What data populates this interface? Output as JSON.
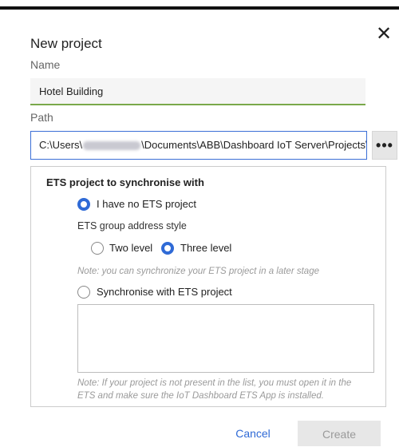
{
  "dialog": {
    "title": "New project",
    "close_icon": "close-icon"
  },
  "name": {
    "label": "Name",
    "value": "Hotel Building"
  },
  "path": {
    "label": "Path",
    "value_prefix": "C:\\Users\\",
    "value_suffix": "\\Documents\\ABB\\Dashboard IoT Server\\Projects\\Ho",
    "browse_icon": "ellipsis-icon"
  },
  "ets": {
    "heading": "ETS project to synchronise with",
    "no_project_label": "I have no ETS project",
    "no_project_selected": true,
    "group_address_label": "ETS group address style",
    "two_level_label": "Two level",
    "three_level_label": "Three level",
    "selected_level": "Three level",
    "note_later": "Note: you can synchronize your ETS project in a later stage",
    "sync_label": "Synchronise with ETS project",
    "sync_selected": false,
    "note_list_line1": "Note: If your project is not present in the list, you must open it in the",
    "note_list_line2": "ETS and make sure the IoT Dashboard ETS App is installed."
  },
  "footer": {
    "cancel_label": "Cancel",
    "create_label": "Create"
  },
  "colors": {
    "accent": "#2f6ad6",
    "name_underline": "#7aa84a",
    "disabled_bg": "#e7e7e7"
  }
}
